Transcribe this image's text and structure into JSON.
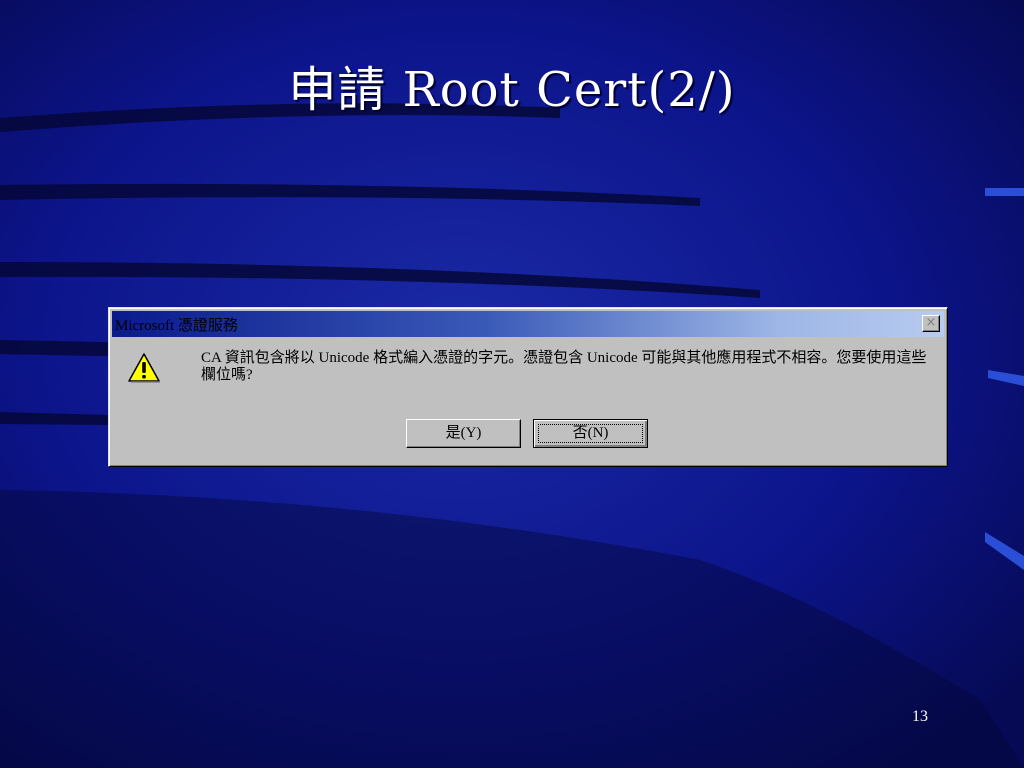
{
  "slide": {
    "title": "申請 Root Cert(2/)",
    "page_number": "13"
  },
  "dialog": {
    "title": "Microsoft 憑證服務",
    "close_glyph": "×",
    "icon": "warning-icon",
    "message": "CA 資訊包含將以 Unicode 格式編入憑證的字元。憑證包含 Unicode 可能與其他應用程式不相容。您要使用這些欄位嗎?",
    "buttons": {
      "yes_label": "是(Y)",
      "no_label": "否(N)"
    }
  },
  "colors": {
    "background": "#0a0f74",
    "dialog_face": "#c0c0c0",
    "titlebar_start": "#0a1a8c",
    "titlebar_end": "#b8cbf0",
    "warning_yellow": "#ffff00"
  }
}
